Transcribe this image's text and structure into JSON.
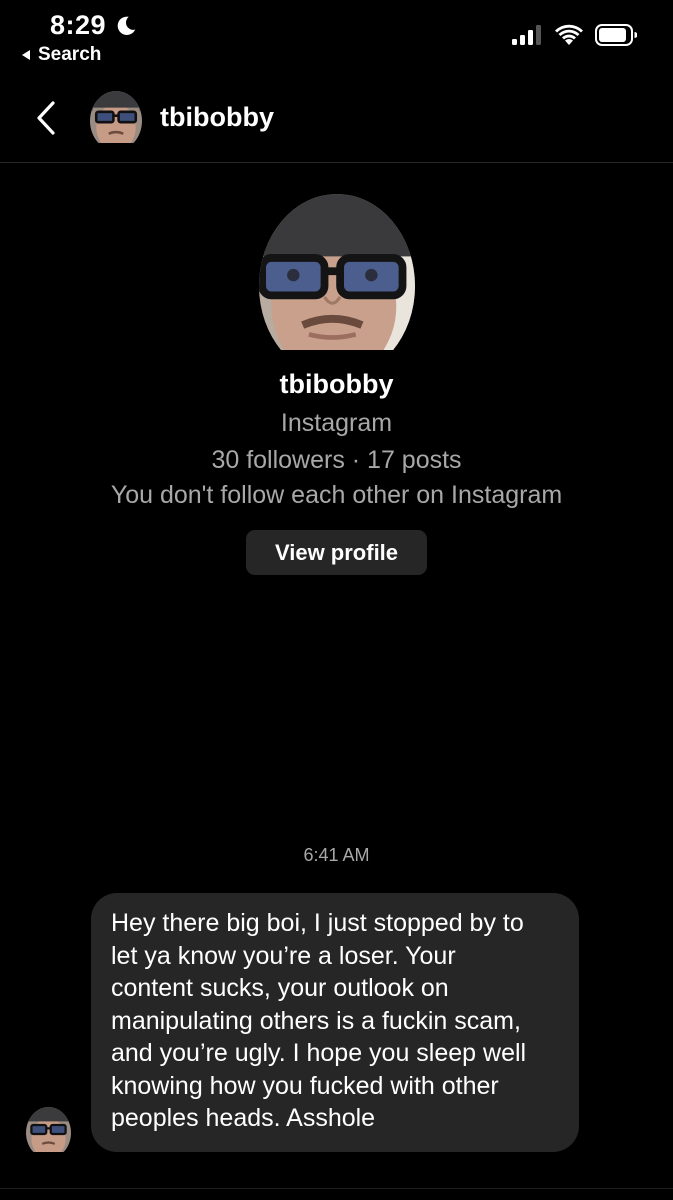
{
  "status_bar": {
    "time": "8:29",
    "back_app_label": "Search",
    "icons": [
      "moon-icon",
      "signal-icon",
      "wifi-icon",
      "battery-icon"
    ]
  },
  "header": {
    "username": "tbibobby",
    "icons": [
      "chevron-left-icon"
    ]
  },
  "profile": {
    "username": "tbibobby",
    "platform": "Instagram",
    "stats": "30 followers · 17 posts",
    "follow_status": "You don't follow each other on Instagram",
    "view_profile_label": "View profile"
  },
  "conversation": {
    "timestamp": "6:41 AM",
    "messages": [
      {
        "text": "Hey there big boi, I just stopped by to\nlet ya know you’re a loser. Your\ncontent sucks, your outlook on\nmanipulating others is a fuckin scam,\nand you’re ugly. I hope you sleep well\nknowing how you fucked with other\npeoples heads. Asshole"
      }
    ]
  },
  "colors": {
    "background": "#000000",
    "bubble": "#262626",
    "secondary_text": "#a8a8a8",
    "primary_text": "#ffffff"
  }
}
